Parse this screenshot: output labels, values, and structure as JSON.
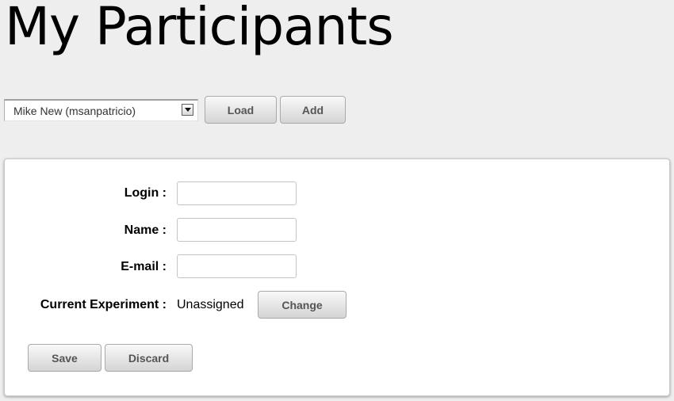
{
  "page": {
    "title": "My Participants"
  },
  "toolbar": {
    "participant_select": {
      "selected": "Mike New (msanpatricio)"
    },
    "load_label": "Load",
    "add_label": "Add"
  },
  "form": {
    "login": {
      "label": "Login :",
      "value": ""
    },
    "name": {
      "label": "Name :",
      "value": ""
    },
    "email": {
      "label": "E-mail :",
      "value": ""
    },
    "experiment": {
      "label": "Current Experiment :",
      "value": "Unassigned",
      "change_label": "Change"
    },
    "save_label": "Save",
    "discard_label": "Discard"
  }
}
